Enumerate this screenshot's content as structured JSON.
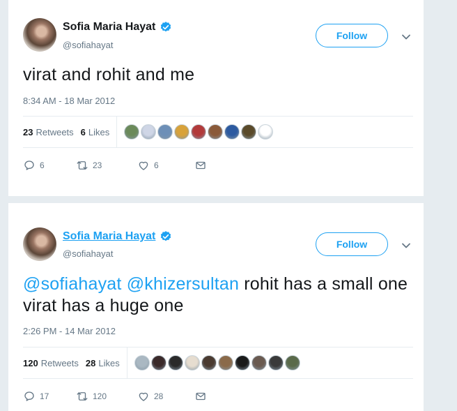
{
  "tweets": [
    {
      "display_name": "Sofia Maria Hayat",
      "handle": "@sofiahayat",
      "follow_label": "Follow",
      "text_plain": "virat and rohit and me",
      "timestamp": "8:34 AM - 18 Mar 2012",
      "retweets_count": "23",
      "retweets_label": "Retweets",
      "likes_count": "6",
      "likes_label": "Likes",
      "reply_count": "6",
      "retweet_action_count": "23",
      "like_action_count": "6",
      "liker_avatar_colors": [
        "#6b8a5a",
        "#cfd6e6",
        "#6d8fb7",
        "#d8a23a",
        "#b23a3a",
        "#8a5a3a",
        "#2c5aa0",
        "#5a4a2a",
        "#ffffff"
      ]
    },
    {
      "display_name": "Sofia Maria Hayat",
      "handle": "@sofiahayat",
      "follow_label": "Follow",
      "text_mention1": "@sofiahayat",
      "text_mention2": "@khizersultan",
      "text_rest": "rohit has a small one virat has a huge one",
      "timestamp": "2:26 PM - 14 Mar 2012",
      "retweets_count": "120",
      "retweets_label": "Retweets",
      "likes_count": "28",
      "likes_label": "Likes",
      "reply_count": "17",
      "retweet_action_count": "120",
      "like_action_count": "28",
      "liker_avatar_colors": [
        "#aab8c2",
        "#3a2a2a",
        "#2a2a2a",
        "#e6ddd0",
        "#4a3a30",
        "#8a6a4a",
        "#1a1a1a",
        "#6a5a50",
        "#3a3a3a",
        "#5a6a4a"
      ]
    }
  ],
  "colors": {
    "accent": "#1da1f2",
    "muted": "#657786",
    "text": "#14171a",
    "background": "#e6ecf0"
  }
}
